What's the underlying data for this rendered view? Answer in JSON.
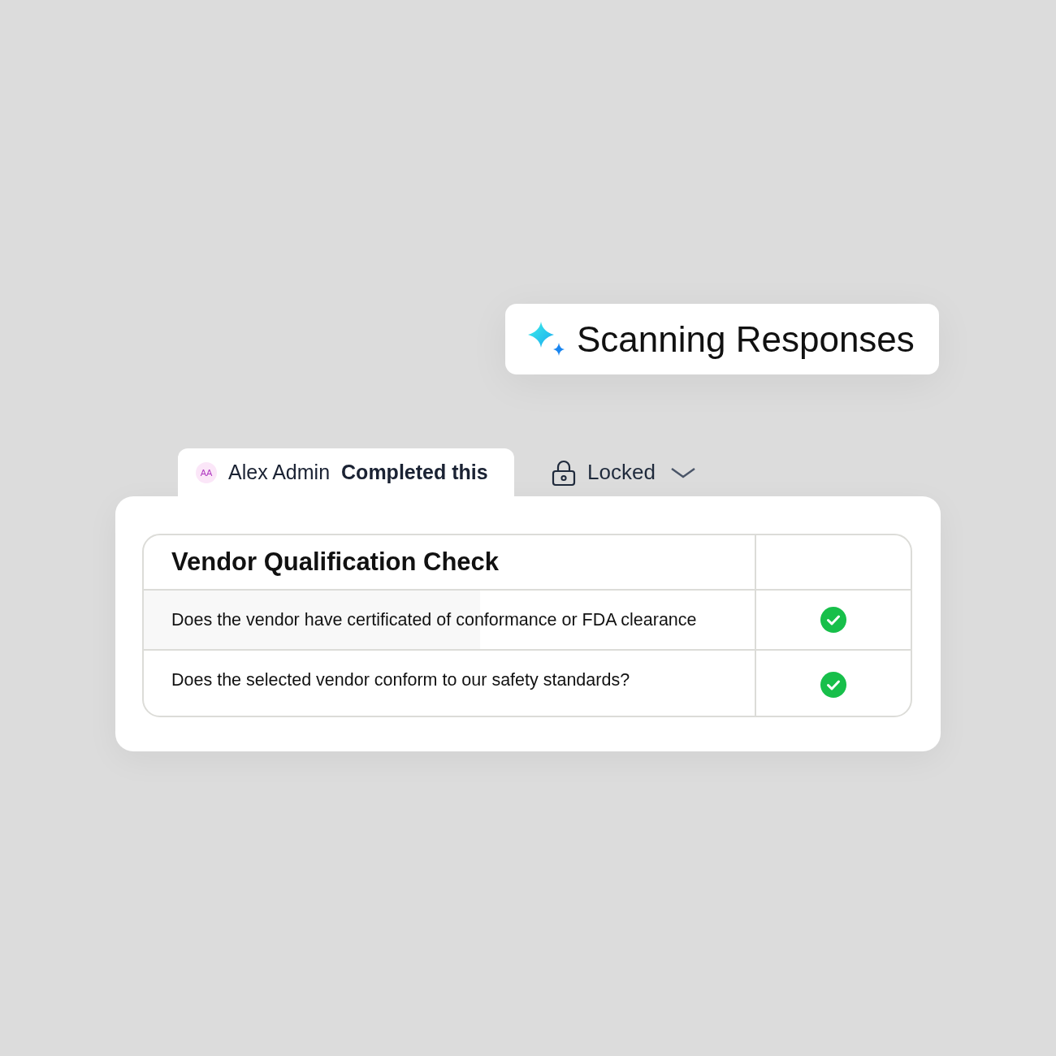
{
  "status_badge": {
    "text": "Scanning Responses"
  },
  "completion_tab": {
    "avatar_initials": "AA",
    "user": "Alex Admin",
    "action": "Completed this"
  },
  "lock_dropdown": {
    "label": "Locked"
  },
  "checklist": {
    "title": "Vendor Qualification Check",
    "rows": [
      {
        "question": "Does the vendor have certificated of conformance or FDA clearance",
        "checked": true
      },
      {
        "question": "Does the selected vendor conform to our safety standards?",
        "checked": true
      }
    ]
  }
}
